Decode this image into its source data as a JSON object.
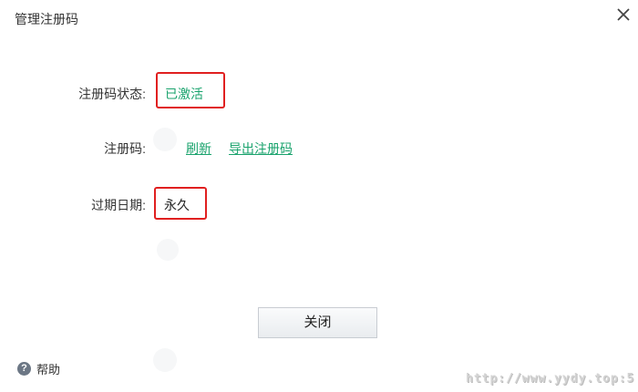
{
  "dialog": {
    "title": "管理注册码",
    "close_icon": "close-icon"
  },
  "fields": {
    "status_label": "注册码状态:",
    "status_value": "已激活",
    "code_label": "注册码:",
    "refresh_link": "刷新",
    "export_link": "导出注册码",
    "expiry_label": "过期日期:",
    "expiry_value": "永久"
  },
  "footer": {
    "close_button": "关闭",
    "help_icon": "question-icon",
    "help_label": "帮助"
  },
  "watermark": "http://www.yydy.top:5",
  "colors": {
    "accent_green": "#1aa36d",
    "highlight_red": "#e02020"
  }
}
